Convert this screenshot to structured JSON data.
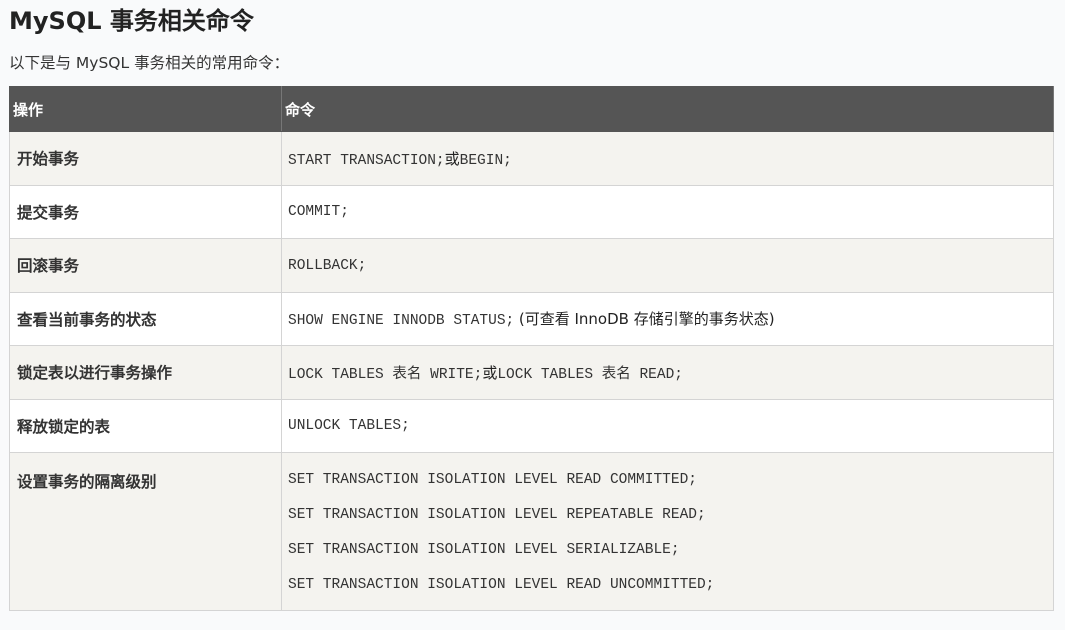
{
  "heading": "MySQL 事务相关命令",
  "intro": "以下是与 MySQL 事务相关的常用命令：",
  "table": {
    "headers": [
      "操作",
      "命令"
    ],
    "rows": [
      {
        "op": "开始事务",
        "cmd": [
          {
            "code": "START TRANSACTION;"
          },
          {
            "text": "或"
          },
          {
            "code": "BEGIN;"
          }
        ]
      },
      {
        "op": "提交事务",
        "cmd": [
          {
            "code": "COMMIT;"
          }
        ]
      },
      {
        "op": "回滚事务",
        "cmd": [
          {
            "code": "ROLLBACK;"
          }
        ]
      },
      {
        "op": "查看当前事务的状态",
        "cmd": [
          {
            "code": "SHOW ENGINE INNODB STATUS;"
          },
          {
            "text": "(可查看 InnoDB 存储引擎的事务状态)"
          }
        ]
      },
      {
        "op": "锁定表以进行事务操作",
        "cmd": [
          {
            "code": "LOCK TABLES 表名 WRITE;"
          },
          {
            "text": "或"
          },
          {
            "code": "LOCK TABLES 表名 READ;"
          }
        ]
      },
      {
        "op": "释放锁定的表",
        "cmd": [
          {
            "code": "UNLOCK TABLES;"
          }
        ]
      }
    ],
    "isolation_row": {
      "op": "设置事务的隔离级别",
      "lines": [
        "SET TRANSACTION ISOLATION LEVEL READ COMMITTED;",
        "SET TRANSACTION ISOLATION LEVEL REPEATABLE READ;",
        "SET TRANSACTION ISOLATION LEVEL SERIALIZABLE;",
        "SET TRANSACTION ISOLATION LEVEL READ UNCOMMITTED;"
      ]
    }
  }
}
